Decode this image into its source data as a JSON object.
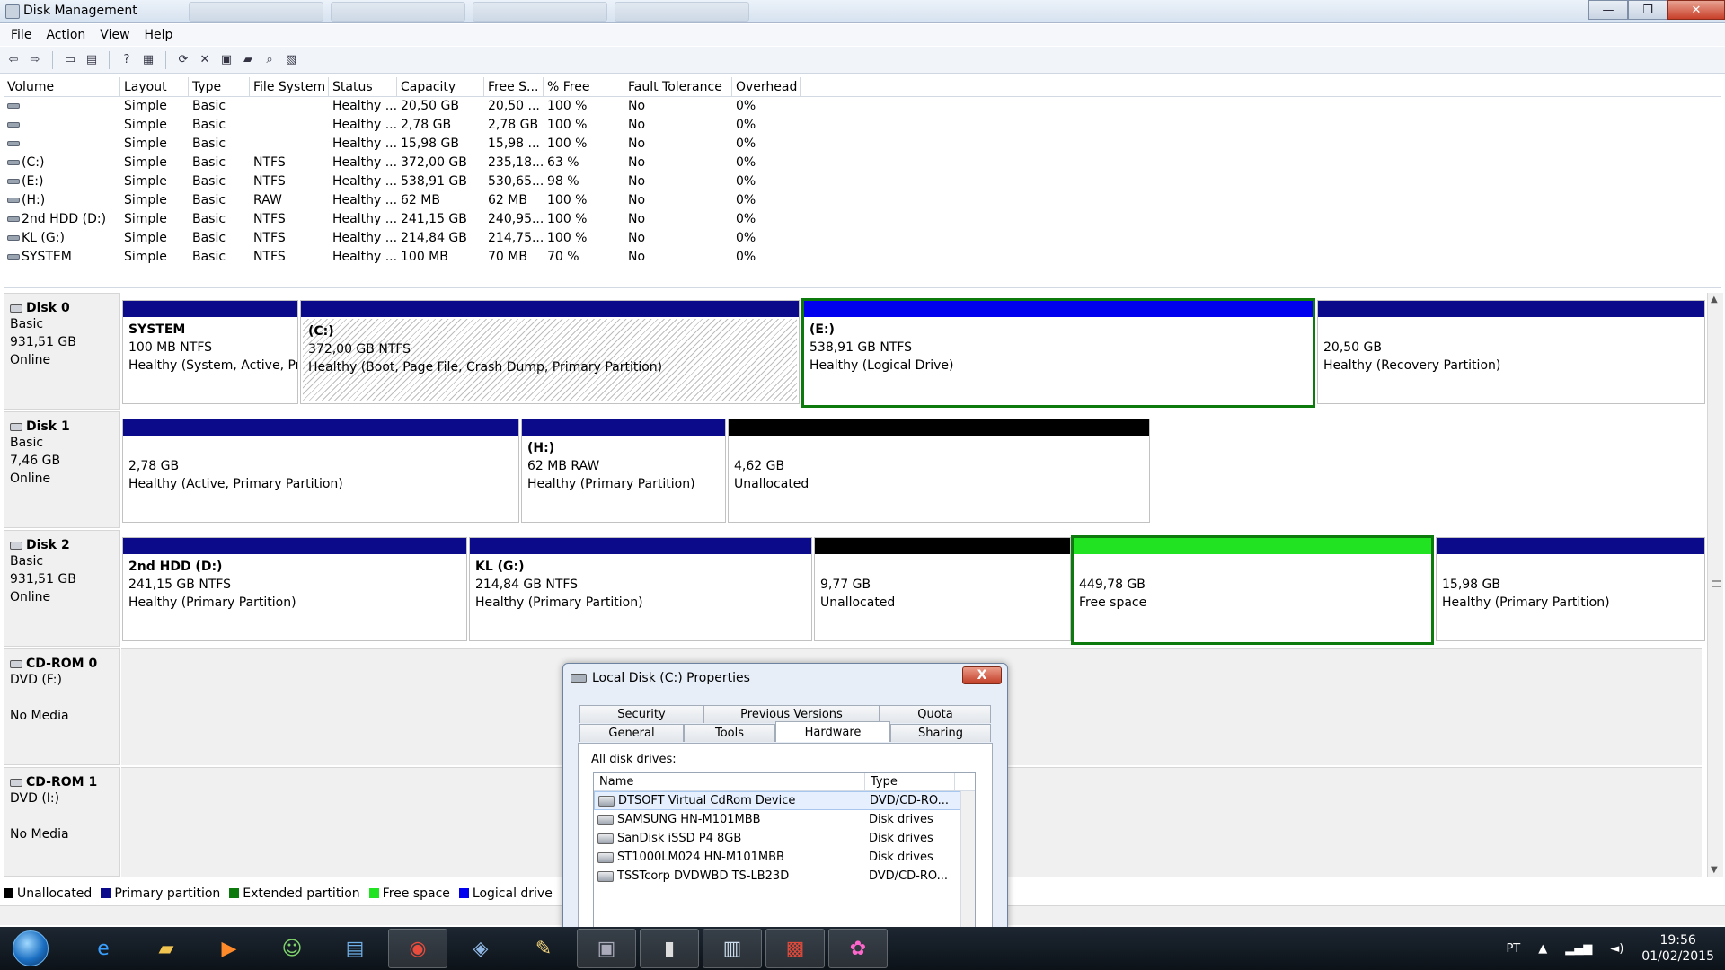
{
  "window": {
    "title": "Disk Management",
    "buttons": {
      "minimize": "—",
      "maximize": "❐",
      "close": "✕"
    }
  },
  "menu": [
    "File",
    "Action",
    "View",
    "Help"
  ],
  "toolbar_icons": [
    "back-arrow-icon",
    "forward-arrow-icon",
    "show-hide-console-icon",
    "properties-icon",
    "help-icon",
    "help-topics-icon",
    "refresh-icon",
    "delete-icon",
    "rescan-icon",
    "open-folder-icon",
    "search-icon",
    "export-icon"
  ],
  "volume_table": {
    "headers": [
      "Volume",
      "Layout",
      "Type",
      "File System",
      "Status",
      "Capacity",
      "Free S...",
      "% Free",
      "Fault Tolerance",
      "Overhead"
    ],
    "rows": [
      [
        "",
        "Simple",
        "Basic",
        "",
        "Healthy ...",
        "20,50 GB",
        "20,50 ...",
        "100 %",
        "No",
        "0%"
      ],
      [
        "",
        "Simple",
        "Basic",
        "",
        "Healthy ...",
        "2,78 GB",
        "2,78 GB",
        "100 %",
        "No",
        "0%"
      ],
      [
        "",
        "Simple",
        "Basic",
        "",
        "Healthy ...",
        "15,98 GB",
        "15,98 ...",
        "100 %",
        "No",
        "0%"
      ],
      [
        "(C:)",
        "Simple",
        "Basic",
        "NTFS",
        "Healthy ...",
        "372,00 GB",
        "235,18...",
        "63 %",
        "No",
        "0%"
      ],
      [
        "(E:)",
        "Simple",
        "Basic",
        "NTFS",
        "Healthy ...",
        "538,91 GB",
        "530,65...",
        "98 %",
        "No",
        "0%"
      ],
      [
        "(H:)",
        "Simple",
        "Basic",
        "RAW",
        "Healthy ...",
        "62 MB",
        "62 MB",
        "100 %",
        "No",
        "0%"
      ],
      [
        "2nd HDD (D:)",
        "Simple",
        "Basic",
        "NTFS",
        "Healthy ...",
        "241,15 GB",
        "240,95...",
        "100 %",
        "No",
        "0%"
      ],
      [
        "KL (G:)",
        "Simple",
        "Basic",
        "NTFS",
        "Healthy ...",
        "214,84 GB",
        "214,75...",
        "100 %",
        "No",
        "0%"
      ],
      [
        "SYSTEM",
        "Simple",
        "Basic",
        "NTFS",
        "Healthy ...",
        "100 MB",
        "70 MB",
        "70 %",
        "No",
        "0%"
      ]
    ]
  },
  "disks": [
    {
      "name": "Disk 0",
      "type": "Basic",
      "size": "931,51 GB",
      "status": "Online",
      "partitions": [
        {
          "name": "SYSTEM",
          "size": "100 MB NTFS",
          "status": "Healthy (System, Active, Prir"
        },
        {
          "name": "(C:)",
          "size": "372,00 GB NTFS",
          "status": "Healthy (Boot, Page File, Crash Dump, Primary Partition)"
        },
        {
          "name": "(E:)",
          "size": "538,91 GB NTFS",
          "status": "Healthy (Logical Drive)"
        },
        {
          "name": "",
          "size": "20,50 GB",
          "status": "Healthy (Recovery Partition)"
        }
      ]
    },
    {
      "name": "Disk 1",
      "type": "Basic",
      "size": "7,46 GB",
      "status": "Online",
      "partitions": [
        {
          "name": "",
          "size": "2,78 GB",
          "status": "Healthy (Active, Primary Partition)"
        },
        {
          "name": "(H:)",
          "size": "62 MB RAW",
          "status": "Healthy (Primary Partition)"
        },
        {
          "name": "",
          "size": "4,62 GB",
          "status": "Unallocated"
        }
      ]
    },
    {
      "name": "Disk 2",
      "type": "Basic",
      "size": "931,51 GB",
      "status": "Online",
      "partitions": [
        {
          "name": "2nd HDD  (D:)",
          "size": "241,15 GB NTFS",
          "status": "Healthy (Primary Partition)"
        },
        {
          "name": "KL  (G:)",
          "size": "214,84 GB NTFS",
          "status": "Healthy (Primary Partition)"
        },
        {
          "name": "",
          "size": "9,77 GB",
          "status": "Unallocated"
        },
        {
          "name": "",
          "size": "449,78 GB",
          "status": "Free space"
        },
        {
          "name": "",
          "size": "15,98 GB",
          "status": "Healthy (Primary Partition)"
        }
      ]
    },
    {
      "name": "CD-ROM 0",
      "type": "DVD (F:)",
      "status": "No Media"
    },
    {
      "name": "CD-ROM 1",
      "type": "DVD (I:)",
      "status": "No Media"
    }
  ],
  "legend": [
    "Unallocated",
    "Primary partition",
    "Extended partition",
    "Free space",
    "Logical drive"
  ],
  "colors": {
    "unallocated": "#000000",
    "primary": "#0a0a8a",
    "extended": "#0c7a0c",
    "free": "#22e322",
    "logical": "#0000ee"
  },
  "dialog": {
    "title": "Local Disk (C:) Properties",
    "close": "X",
    "tabs_top": [
      "Security",
      "Previous Versions",
      "Quota"
    ],
    "tabs_bottom": [
      "General",
      "Tools",
      "Hardware",
      "Sharing"
    ],
    "active_tab": "Hardware",
    "label": "All disk drives:",
    "list_headers": [
      "Name",
      "Type"
    ],
    "drives": [
      {
        "name": "DTSOFT Virtual CdRom Device",
        "type": "DVD/CD-RO..."
      },
      {
        "name": "SAMSUNG HN-M101MBB",
        "type": "Disk drives"
      },
      {
        "name": "SanDisk iSSD P4 8GB",
        "type": "Disk drives"
      },
      {
        "name": "ST1000LM024 HN-M101MBB",
        "type": "Disk drives"
      },
      {
        "name": "TSSTcorp DVDWBD TS-LB23D",
        "type": "DVD/CD-RO..."
      }
    ]
  },
  "taskbar": {
    "apps": [
      "internet-explorer-icon",
      "explorer-icon",
      "media-player-icon",
      "messenger-icon",
      "folder-window-icon",
      "chrome-icon",
      "virtualbox-icon",
      "paint-icon",
      "file-lock-icon",
      "cmd-icon",
      "window-app-icon",
      "toolbox-icon",
      "paint-palette-icon"
    ],
    "language": "PT",
    "time": "19:56",
    "date": "01/02/2015"
  }
}
